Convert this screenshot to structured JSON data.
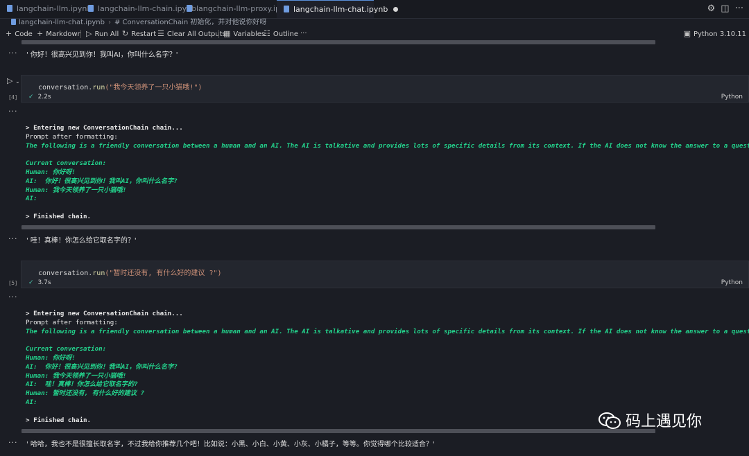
{
  "tabs": [
    {
      "label": "langchain-llm.ipynb",
      "active": false
    },
    {
      "label": "langchain-llm-chain.ipynb",
      "active": false
    },
    {
      "label": "langchain-llm-proxy.ipynb",
      "active": false
    },
    {
      "label": "langchain-llm-chat.ipynb",
      "active": true
    }
  ],
  "tab_actions": {
    "settings_icon": "gear-icon",
    "split_icon": "split-editor-icon",
    "more": "···"
  },
  "breadcrumb": {
    "file": "langchain-llm-chat.ipynb",
    "section": "# ConversationChain 初始化，并对他说你好呀"
  },
  "toolbar": {
    "code": "Code",
    "markdown": "Markdown",
    "run_all": "Run All",
    "restart": "Restart",
    "clear_all": "Clear All Outputs",
    "variables": "Variables",
    "outline": "Outline",
    "more": "···",
    "kernel": "Python 3.10.11"
  },
  "cells": {
    "prev_output": "' 你好！很高兴见到你！我叫AI，你叫什么名字？'",
    "cell4": {
      "exec_count": "[4]",
      "code_obj": "conversation.",
      "code_fn": "run",
      "code_arg": "(\"我今天领养了一只小猫哦!\")",
      "time": "2.2s",
      "lang": "Python",
      "output_result": "' 哇！真棒！你怎么给它取名字的？'"
    },
    "cell5": {
      "exec_count": "[5]",
      "code_obj": "conversation.",
      "code_fn": "run",
      "code_arg": "(\"暂时还没有, 有什么好的建议 ?\")",
      "time": "3.7s",
      "lang": "Python",
      "output_result": "' 哈哈，我也不是很擅长取名字，不过我给你推荐几个吧！比如说：小黑、小白、小黄、小灰、小橘子，等等。你觉得哪个比较适合？'"
    },
    "trace": {
      "entering": "> Entering new ConversationChain chain...",
      "prompt_after": "Prompt after formatting:",
      "following": "The following is a friendly conversation between a human and an AI. The AI is talkative and provides lots of specific details from its context. If the AI does not know the answer to a question, it trut",
      "current": "Current conversation:",
      "human1": "Human: 你好呀!",
      "ai1": "AI:  你好！很高兴见到你！我叫AI，你叫什么名字?",
      "human2": "Human: 我今天领养了一只小猫哦!",
      "ai2": "AI:  哇！真棒！你怎么给它取名字的?",
      "human3": "Human: 暂时还没有, 有什么好的建议 ?",
      "ai_empty": "AI:",
      "finished": "> Finished chain."
    },
    "ellipsis": "···"
  },
  "watermark": {
    "text": "码上遇见你",
    "icon": "wechat-icon"
  }
}
